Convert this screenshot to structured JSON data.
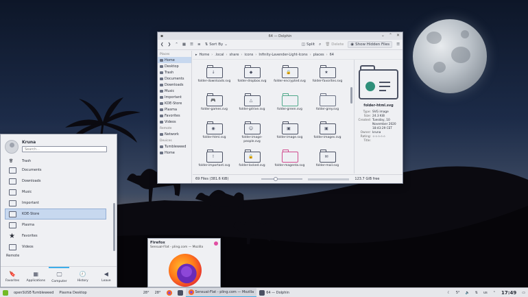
{
  "dolphin": {
    "title": "64 — Dolphin",
    "toolbar": {
      "sort_label": "Sort By",
      "split_label": "Split",
      "delete_label": "Delete",
      "hidden_label": "Show Hidden Files"
    },
    "places_header": "Places",
    "places": [
      "Home",
      "Desktop",
      "Trash",
      "Documents",
      "Downloads",
      "Music",
      "Important",
      "KDE-Store",
      "Plasma",
      "Favorites",
      "Videos"
    ],
    "remote_header": "Remote",
    "remote": [
      "Network"
    ],
    "devices_header": "Devices",
    "devices": [
      "Tumbleweed",
      "Home"
    ],
    "breadcrumb": [
      "Home",
      ".local",
      "share",
      "icons",
      "Infinity-Lavender-Light-Icons",
      "places",
      "64"
    ],
    "files": [
      {
        "name": "folder-downloads.svg",
        "glyph": "↓"
      },
      {
        "name": "folder-dropbox.svg",
        "glyph": "◆"
      },
      {
        "name": "folder-encrypted.svg",
        "glyph": "🔒"
      },
      {
        "name": "folder-favorites.svg",
        "glyph": "★"
      },
      {
        "name": "folder-games.svg",
        "glyph": "🎮"
      },
      {
        "name": "folder-gdrive.svg",
        "glyph": "△"
      },
      {
        "name": "folder-green.svg",
        "glyph": ""
      },
      {
        "name": "folder-grey.svg",
        "glyph": ""
      },
      {
        "name": "folder-html.svg",
        "glyph": "◉"
      },
      {
        "name": "folder-image-people.svg",
        "glyph": "☺"
      },
      {
        "name": "folder-image.svg",
        "glyph": "▣"
      },
      {
        "name": "folder-images.svg",
        "glyph": "▣"
      },
      {
        "name": "folder-important.svg",
        "glyph": "!"
      },
      {
        "name": "folder-locked.svg",
        "glyph": "🔒"
      },
      {
        "name": "folder-magenta.svg",
        "glyph": ""
      },
      {
        "name": "folder-mail.svg",
        "glyph": "✉"
      }
    ],
    "info": {
      "filename": "folder-html.svg",
      "rows": [
        {
          "k": "Type:",
          "v": "SVG image"
        },
        {
          "k": "Size:",
          "v": "24.3 KiB"
        },
        {
          "k": "Created:",
          "v": "Tuesday, 10 November 2020 18:43:29 CET"
        },
        {
          "k": "Owner:",
          "v": "kruna"
        },
        {
          "k": "Rating:",
          "v": "☆☆☆☆☆"
        },
        {
          "k": "Title:",
          "v": ""
        }
      ]
    },
    "status": {
      "count": "69 Files (381.6 KiB)",
      "free": "123.7 GiB free"
    }
  },
  "kickoff": {
    "user": "Kruna",
    "search_placeholder": "Search...",
    "items": [
      {
        "label": "Trash"
      },
      {
        "label": "Documents"
      },
      {
        "label": "Downloads"
      },
      {
        "label": "Music"
      },
      {
        "label": "Important"
      },
      {
        "label": "KDE-Store"
      },
      {
        "label": "Plasma"
      },
      {
        "label": "Favorites"
      },
      {
        "label": "Videos"
      }
    ],
    "remote_label": "Remote",
    "tabs": [
      {
        "label": "Favorites",
        "icon": "🔖"
      },
      {
        "label": "Applications",
        "icon": "▦"
      },
      {
        "label": "Computer",
        "icon": "🖵"
      },
      {
        "label": "History",
        "icon": "🕘"
      },
      {
        "label": "Leave",
        "icon": "◀"
      }
    ]
  },
  "tooltip": {
    "title": "Firefox",
    "subtitle": "Sensual-Flat - pling.com — Mozilla"
  },
  "panel": {
    "distro": "openSUSE-Tumbleweed",
    "desktop": "Plasma Desktop",
    "temp1": "28°",
    "temp2": "28°",
    "task1": "Sensual-Flat - pling.com — Mozilla",
    "task2": "64 — Dolphin",
    "weather": "5°",
    "layout": "us",
    "clock": "17:49"
  }
}
